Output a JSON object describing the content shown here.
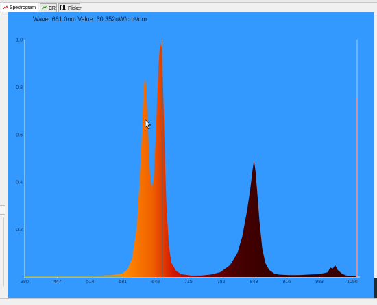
{
  "tabs": [
    {
      "label": "Spectrogram",
      "icon": "spectrogram-icon",
      "active": true
    },
    {
      "label": "CRI",
      "icon": "cri-icon",
      "active": false
    },
    {
      "label": "Flicker",
      "icon": "flicker-icon",
      "active": false
    }
  ],
  "readout": {
    "wave_label": "Wave:",
    "wave_value": "661.0nm",
    "value_label": "Value:",
    "value_value": "60.352uW/cm²/nm"
  },
  "colors": {
    "plot_background": "#3399ff",
    "gradient_start": "#ff8a00",
    "gradient_mid": "#cc1100",
    "gradient_end": "#3a0000"
  },
  "chart_data": {
    "type": "area",
    "x_ticks": [
      380,
      447,
      514,
      581,
      648,
      715,
      782,
      849,
      916,
      983,
      1050
    ],
    "y_ticks": [
      "0.2",
      "0.4",
      "0.6",
      "0.8",
      "1.0"
    ],
    "xlim": [
      380,
      1060
    ],
    "ylim": [
      0,
      1.0
    ],
    "series": [
      {
        "x": [
          380,
          450,
          520,
          560,
          580,
          590,
          600,
          610,
          618,
          623,
          626,
          629,
          632,
          636,
          640,
          644,
          648,
          651,
          654,
          656,
          658,
          660,
          661,
          662,
          664,
          667,
          670,
          675,
          680,
          690,
          700,
          720,
          740,
          760,
          780,
          800,
          815,
          825,
          835,
          842,
          846,
          849,
          852,
          856,
          860,
          866,
          872,
          880,
          890,
          900,
          920,
          940,
          960,
          980,
          990,
          1000,
          1005,
          1010,
          1015,
          1020,
          1030,
          1040,
          1050,
          1060
        ],
        "y": [
          0.002,
          0.003,
          0.005,
          0.008,
          0.015,
          0.03,
          0.08,
          0.22,
          0.52,
          0.78,
          0.85,
          0.78,
          0.64,
          0.44,
          0.37,
          0.42,
          0.58,
          0.76,
          0.9,
          0.96,
          0.98,
          0.97,
          0.94,
          0.88,
          0.72,
          0.48,
          0.3,
          0.13,
          0.06,
          0.025,
          0.012,
          0.006,
          0.006,
          0.01,
          0.02,
          0.05,
          0.1,
          0.17,
          0.28,
          0.38,
          0.45,
          0.49,
          0.45,
          0.35,
          0.24,
          0.12,
          0.06,
          0.03,
          0.015,
          0.01,
          0.008,
          0.008,
          0.01,
          0.012,
          0.015,
          0.02,
          0.04,
          0.035,
          0.05,
          0.03,
          0.012,
          0.005,
          0.003,
          0.002
        ]
      }
    ],
    "cursor_x": 661.0,
    "grid": false
  }
}
